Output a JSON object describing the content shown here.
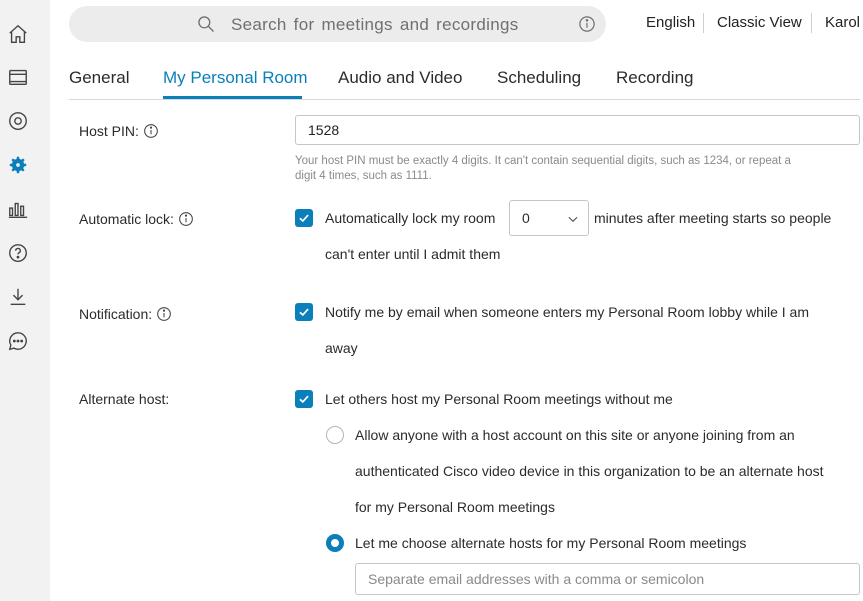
{
  "rail": {
    "icons": [
      "home-icon",
      "calendar-icon",
      "record-icon",
      "gear-icon",
      "analytics-icon",
      "help-icon",
      "download-icon",
      "chat-icon"
    ]
  },
  "search": {
    "placeholder": "Search for meetings and recordings"
  },
  "topnav": {
    "language": "English",
    "classic_view": "Classic View",
    "user": "Karol"
  },
  "tabs": [
    "General",
    "My Personal Room",
    "Audio and Video",
    "Scheduling",
    "Recording"
  ],
  "active_tab": "My Personal Room",
  "accent_color": "#0a7fba",
  "host_pin": {
    "label": "Host PIN:",
    "value": "1528",
    "help_line1": "Your host PIN must be exactly 4 digits. It can't contain sequential digits, such as 1234, or repeat a",
    "help_line2": "digit 4 times, such as 1111."
  },
  "automatic_lock": {
    "label": "Automatic lock:",
    "checked": true,
    "text_before": "Automatically lock my room",
    "minutes": "0",
    "text_after": "minutes after meeting starts so people",
    "text_line2": "can't enter until I admit them"
  },
  "notification": {
    "label": "Notification:",
    "checked": true,
    "text_line1": "Notify me by email when someone enters my Personal Room lobby while I am",
    "text_line2": "away"
  },
  "alternate_host": {
    "label": "Alternate host:",
    "checked": true,
    "text": "Let others host my Personal Room meetings without me",
    "option1_line1": "Allow anyone with a host account on this site or anyone joining from an",
    "option1_line2": "authenticated Cisco video device in this organization to be an alternate host",
    "option1_line3": "for my Personal Room meetings",
    "option1_selected": false,
    "option2": "Let me choose alternate hosts for my Personal Room meetings",
    "option2_selected": true,
    "emails_placeholder": "Separate email addresses with a comma or semicolon"
  }
}
